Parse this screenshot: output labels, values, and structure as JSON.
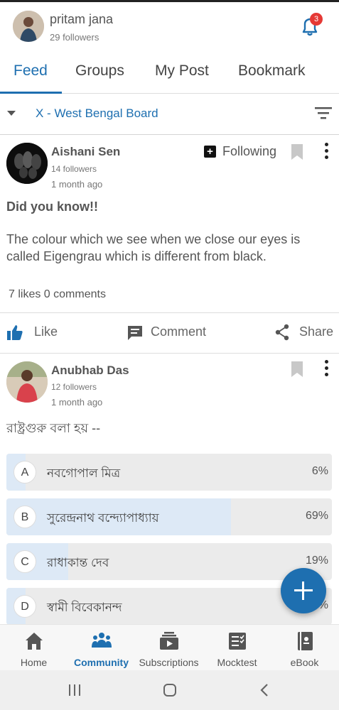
{
  "header": {
    "user_name": "pritam jana",
    "followers": "29 followers",
    "notification_count": "3"
  },
  "tabs": [
    {
      "label": "Feed",
      "active": true
    },
    {
      "label": "Groups",
      "active": false
    },
    {
      "label": "My Post",
      "active": false
    },
    {
      "label": "Bookmark",
      "active": false
    }
  ],
  "board": {
    "label": "X - West Bengal Board"
  },
  "post1": {
    "author": "Aishani Sen",
    "followers": "14 followers",
    "time": "1 month ago",
    "following_label": "Following",
    "title": "Did you know!!",
    "body": "The colour which we see when we close our eyes is called Eigengrau which is different from black.",
    "stats": "7 likes 0 comments"
  },
  "actions": {
    "like": "Like",
    "comment": "Comment",
    "share": "Share"
  },
  "post2": {
    "author": "Anubhab Das",
    "followers": "12 followers",
    "time": "1 month ago",
    "question": "রাষ্ট্রগুরু বলা হয় --",
    "options": [
      {
        "letter": "A",
        "text": "নবগোপাল মিত্র",
        "percent": "6%",
        "fraction": 0.06
      },
      {
        "letter": "B",
        "text": "সুরেন্দ্রনাথ বন্দ্যোপাধ্যায়",
        "percent": "69%",
        "fraction": 0.69
      },
      {
        "letter": "C",
        "text": "রাধাকান্ত দেব",
        "percent": "19%",
        "fraction": 0.19
      },
      {
        "letter": "D",
        "text": "স্বামী বিবেকানন্দ",
        "percent": "6%",
        "fraction": 0.06
      }
    ]
  },
  "bottom_nav": [
    {
      "label": "Home",
      "icon": "home-icon",
      "active": false
    },
    {
      "label": "Community",
      "icon": "community-icon",
      "active": true
    },
    {
      "label": "Subscriptions",
      "icon": "subscriptions-icon",
      "active": false
    },
    {
      "label": "Mocktest",
      "icon": "mocktest-icon",
      "active": false
    },
    {
      "label": "eBook",
      "icon": "ebook-icon",
      "active": false
    }
  ],
  "colors": {
    "accent": "#1e6fb0",
    "badge": "#e53935"
  }
}
